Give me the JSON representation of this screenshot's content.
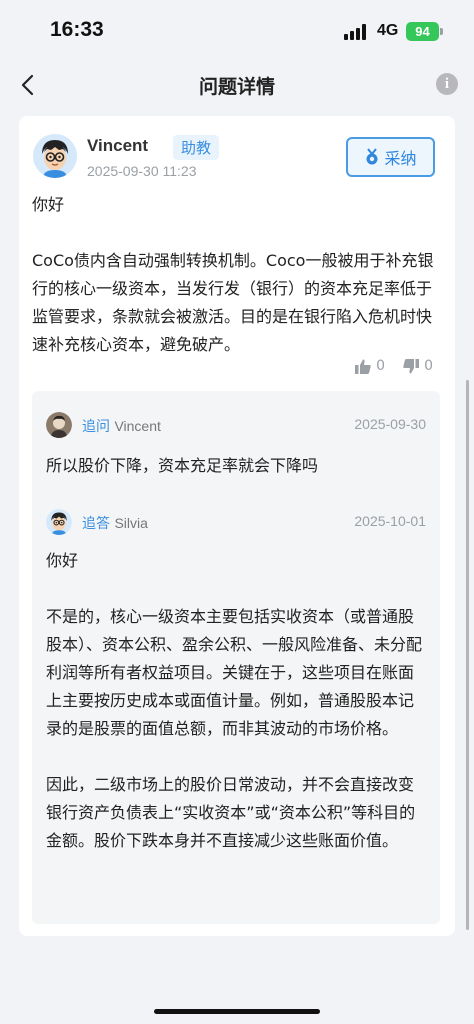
{
  "status_bar": {
    "time": "16:33",
    "network": "4G",
    "battery": "94"
  },
  "nav": {
    "title": "问题详情",
    "info_icon": "i"
  },
  "answer": {
    "author": "Vincent",
    "role": "助教",
    "time": "2025-09-30 11:23",
    "adopt_label": "采纳",
    "greeting": "你好",
    "body": "CoCo债内含自动强制转换机制。Coco一般被用于补充银行的核心一级资本，当发行发（银行）的资本充足率低于监管要求，条款就会被激活。目的是在银行陷入危机时快速补充核心资本，避免破产。",
    "likes": "0",
    "dislikes": "0"
  },
  "thread": {
    "followup": {
      "tag": "追问",
      "user": "Vincent",
      "date": "2025-09-30",
      "text": "所以股价下降，资本充足率就会下降吗"
    },
    "reply": {
      "tag": "追答",
      "user": "Silvia",
      "date": "2025-10-01",
      "greeting": "你好",
      "para1": "不是的，核心一级资本主要包括实收资本（或普通股股本）、资本公积、盈余公积、一般风险准备、未分配利润等所有者权益项目。关键在于，这些项目在账面上主要按历史成本或面值计量。例如，普通股股本记录的是股票的面值总额，而非其波动的市场价格。",
      "para2": "因此，二级市场上的股价日常波动，并不会直接改变银行资产负债表上“实收资本”或“资本公积”等科目的金额。股价下跌本身并不直接减少这些账面价值。"
    }
  },
  "colors": {
    "accent": "#3a8ee0",
    "badge_bg": "#e9f3fc",
    "battery": "#35c759",
    "page_bg": "#f2f3f6"
  }
}
